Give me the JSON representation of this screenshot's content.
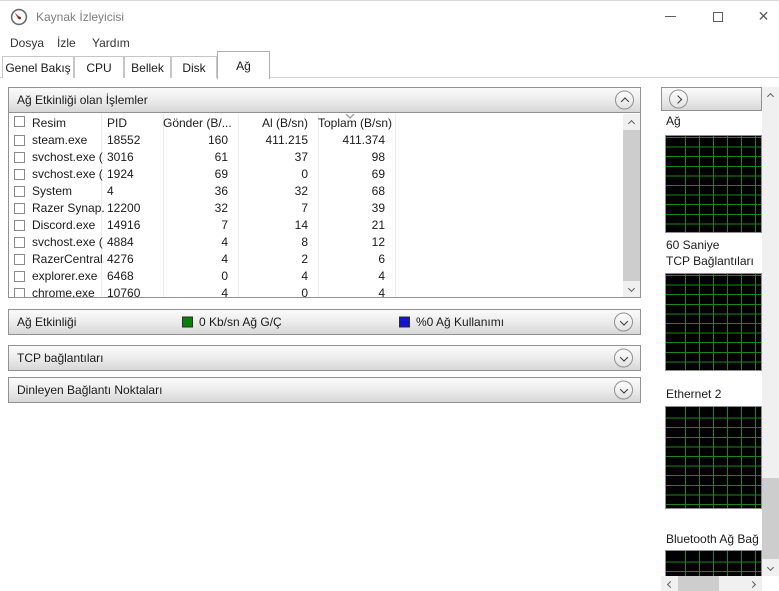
{
  "window": {
    "title": "Kaynak İzleyicisi",
    "close_glyph": "✕"
  },
  "menu": {
    "items": [
      "Dosya",
      "İzle",
      "Yardım"
    ]
  },
  "tabs": {
    "items": [
      "Genel Bakış",
      "CPU",
      "Bellek",
      "Disk",
      "Ağ"
    ],
    "active": "Ağ"
  },
  "process_panel": {
    "title": "Ağ Etkinliği olan İşlemler",
    "columns": {
      "image": "Resim",
      "pid": "PID",
      "send": "Gönder (B/...",
      "recv": "Al (B/sn)",
      "total": "Toplam (B/sn)"
    },
    "sort_column": "Toplam (B/sn)",
    "rows": [
      {
        "name": "steam.exe",
        "pid": "18552",
        "send": "160",
        "recv": "411.215",
        "total": "411.374"
      },
      {
        "name": "svchost.exe (...",
        "pid": "3016",
        "send": "61",
        "recv": "37",
        "total": "98"
      },
      {
        "name": "svchost.exe (...",
        "pid": "1924",
        "send": "69",
        "recv": "0",
        "total": "69"
      },
      {
        "name": "System",
        "pid": "4",
        "send": "36",
        "recv": "32",
        "total": "68"
      },
      {
        "name": "Razer Synap...",
        "pid": "12200",
        "send": "32",
        "recv": "7",
        "total": "39"
      },
      {
        "name": "Discord.exe",
        "pid": "14916",
        "send": "7",
        "recv": "14",
        "total": "21"
      },
      {
        "name": "svchost.exe (...",
        "pid": "4884",
        "send": "4",
        "recv": "8",
        "total": "12"
      },
      {
        "name": "RazerCentral...",
        "pid": "4276",
        "send": "4",
        "recv": "2",
        "total": "6"
      },
      {
        "name": "explorer.exe",
        "pid": "6468",
        "send": "0",
        "recv": "4",
        "total": "4"
      },
      {
        "name": "chrome.exe",
        "pid": "10760",
        "send": "4",
        "recv": "0",
        "total": "4"
      }
    ]
  },
  "activity_bar": {
    "title": "Ağ Etkinliği",
    "io_label": "0 Kb/sn Ağ G/Ç",
    "io_color": "#0c7e0c",
    "usage_label": "%0 Ağ Kullanımı",
    "usage_color": "#1414cc"
  },
  "tcp_bar": {
    "title": "TCP bağlantıları"
  },
  "listen_bar": {
    "title": "Dinleyen Bağlantı Noktaları"
  },
  "sidebar": {
    "graph1_title": "Ağ",
    "graph1_sub": "60 Saniye",
    "graph2_title": "TCP Bağlantıları",
    "graph3_title": "Ethernet 2",
    "graph4_title": "Bluetooth Ağ Bağ",
    "graph_bg": "#000000",
    "grid_color": "#178717"
  }
}
